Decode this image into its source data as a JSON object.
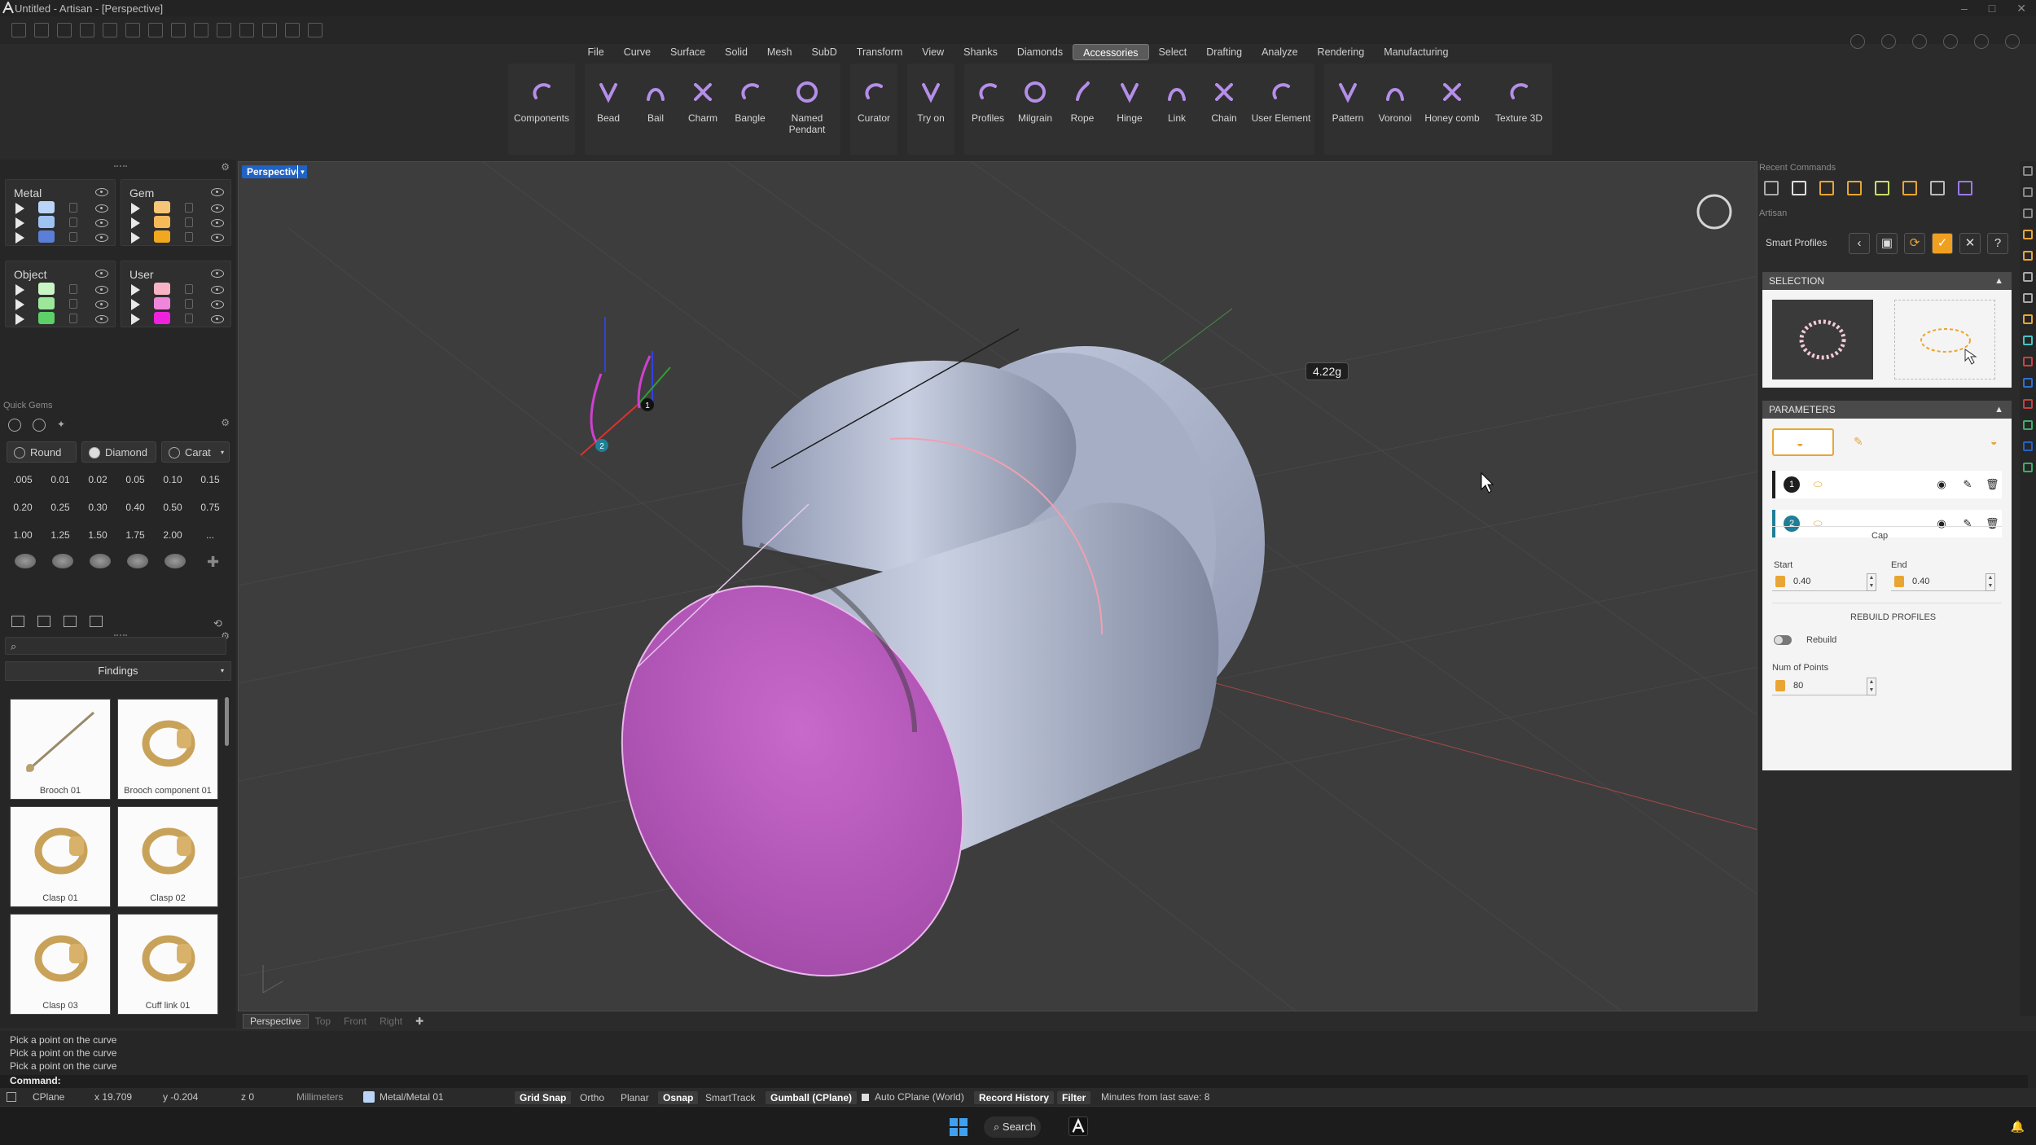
{
  "window": {
    "title": "Untitled - Artisan - [Perspective]"
  },
  "menu": [
    "File",
    "Curve",
    "Surface",
    "Solid",
    "Mesh",
    "SubD",
    "Transform",
    "View",
    "Shanks",
    "Diamonds",
    "Accessories",
    "Select",
    "Drafting",
    "Analyze",
    "Rendering",
    "Manufacturing"
  ],
  "menu_active": "Accessories",
  "ribbon": [
    [
      "Components"
    ],
    [
      "Bead",
      "Bail",
      "Charm",
      "Bangle",
      "Named Pendant"
    ],
    [
      "Curator"
    ],
    [
      "Try on"
    ],
    [
      "Profiles",
      "Milgrain",
      "Rope",
      "Hinge",
      "Link",
      "Chain",
      "User Element"
    ],
    [
      "Pattern",
      "Voronoi",
      "Honey comb",
      "Texture 3D"
    ]
  ],
  "layers": {
    "metal": {
      "title": "Metal",
      "colors": [
        "#b9d4f7",
        "#9ec2f2",
        "#5b7fd6"
      ]
    },
    "gem": {
      "title": "Gem",
      "colors": [
        "#f6c577",
        "#f4ba5a",
        "#f2a81e"
      ]
    },
    "object": {
      "title": "Object",
      "colors": [
        "#c9f5c5",
        "#9be89a",
        "#5dd067"
      ]
    },
    "user": {
      "title": "User",
      "colors": [
        "#f7b3c5",
        "#f086dc",
        "#ee22dd"
      ]
    }
  },
  "quick_gems": {
    "label": "Quick Gems",
    "shape": "Round",
    "type": "Diamond",
    "unit": "Carat",
    "sizes": [
      ".005",
      "0.01",
      "0.02",
      "0.05",
      "0.10",
      "0.15",
      "0.20",
      "0.25",
      "0.30",
      "0.40",
      "0.50",
      "0.75",
      "1.00",
      "1.25",
      "1.50",
      "1.75",
      "2.00",
      "..."
    ]
  },
  "library": {
    "search_placeholder": "",
    "category": "Findings",
    "items": [
      "Brooch 01",
      "Brooch component 01",
      "Clasp 01",
      "Clasp 02",
      "Clasp 03",
      "Cuff link 01"
    ]
  },
  "viewport": {
    "label": "Perspective",
    "weight_label": "4.22g",
    "point1": "1",
    "point2": "2"
  },
  "view_tabs": [
    "Perspective",
    "Top",
    "Front",
    "Right"
  ],
  "right_panel": {
    "recent_commands_label": "Recent Commands",
    "artisan_label": "Artisan",
    "smart_profiles": "Smart Profiles",
    "selection_label": "SELECTION",
    "parameters_label": "PARAMETERS",
    "profile_rows": [
      {
        "num": "1",
        "color": "#1e1e1e"
      },
      {
        "num": "2",
        "color": "#1f7f96"
      }
    ],
    "cap_label": "Cap",
    "start_label": "Start",
    "start_value": "0.40",
    "end_label": "End",
    "end_value": "0.40",
    "rebuild_section": "REBUILD PROFILES",
    "rebuild_label": "Rebuild",
    "num_points_label": "Num of Points",
    "num_points_value": "80"
  },
  "command_history": [
    "Pick a point on the curve",
    "Pick a point on the curve",
    "Pick a point on the curve"
  ],
  "command_prompt": "Command:",
  "status": {
    "cplane": "CPlane",
    "x": "x 19.709",
    "y": "y -0.204",
    "z": "z 0",
    "units": "Millimeters",
    "layer": "Metal/Metal 01",
    "grid_snap": "Grid Snap",
    "ortho": "Ortho",
    "planar": "Planar",
    "osnap": "Osnap",
    "smarttrack": "SmartTrack",
    "gumball": "Gumball (CPlane)",
    "auto_cplane": "Auto CPlane (World)",
    "record_history": "Record History",
    "filter": "Filter",
    "last_save": "Minutes from last save: 8"
  },
  "taskbar": {
    "search": "Search"
  },
  "colors": {
    "accent_blue": "#1f63c7",
    "metal": "#b4bdd6",
    "inner_surface": "#c45ac3"
  }
}
